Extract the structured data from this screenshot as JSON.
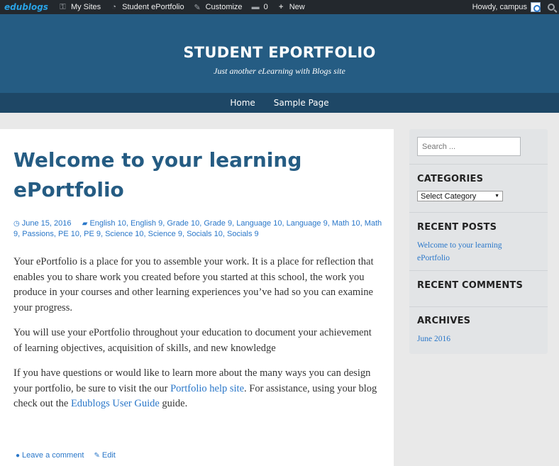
{
  "adminbar": {
    "logo": "edublogs",
    "items": [
      {
        "icon": "key-icon",
        "label": "My Sites"
      },
      {
        "icon": "dashboard-icon",
        "label": "Student ePortfolio"
      },
      {
        "icon": "brush-icon",
        "label": "Customize"
      },
      {
        "icon": "comment-icon",
        "label": "0"
      },
      {
        "icon": "plus-icon",
        "label": "New"
      }
    ],
    "greeting": "Howdy, campus"
  },
  "header": {
    "title": "STUDENT EPORTFOLIO",
    "description": "Just another eLearning with Blogs site"
  },
  "nav": [
    "Home",
    "Sample Page"
  ],
  "post": {
    "title": "Welcome to your learning ePortfolio",
    "date": "June 15, 2016",
    "categories": [
      "English 10",
      "English 9",
      "Grade 10",
      "Grade 9",
      "Language 10",
      "Language 9",
      "Math 10",
      "Math 9",
      "Passions",
      "PE 10",
      "PE 9",
      "Science 10",
      "Science 9",
      "Socials 10",
      "Socials 9"
    ],
    "p1": "Your ePortfolio is a place for you to assemble your work.  It is a place for reflection that enables you to share work you created before you started at this school, the work you produce in your courses and other learning experiences you’ve had so you can examine your progress.",
    "p2": "You will use your ePortfolio throughout your education to document your achievement of learning objectives, acquisition of skills, and new knowledge",
    "p3_before": "If you have questions or would like to learn more about the many ways you can design your portfolio, be sure to visit the our ",
    "p3_link1": "Portfolio help site",
    "p3_middle": ".  For assistance, using your blog check out the ",
    "p3_link2": "Edublogs User Guide",
    "p3_after": " guide.",
    "leave_comment": "Leave a comment",
    "edit": "Edit"
  },
  "sidebar": {
    "search_placeholder": "Search ...",
    "categories_title": "CATEGORIES",
    "category_select": "Select Category",
    "recent_posts_title": "RECENT POSTS",
    "recent_post": "Welcome to your learning ePortfolio",
    "recent_comments_title": "RECENT COMMENTS",
    "archives_title": "ARCHIVES",
    "archive": "June 2016"
  },
  "colors": {
    "header": "#255c83",
    "nav": "#1e4766",
    "adminbar": "#23282d",
    "link": "#2a77c9"
  }
}
